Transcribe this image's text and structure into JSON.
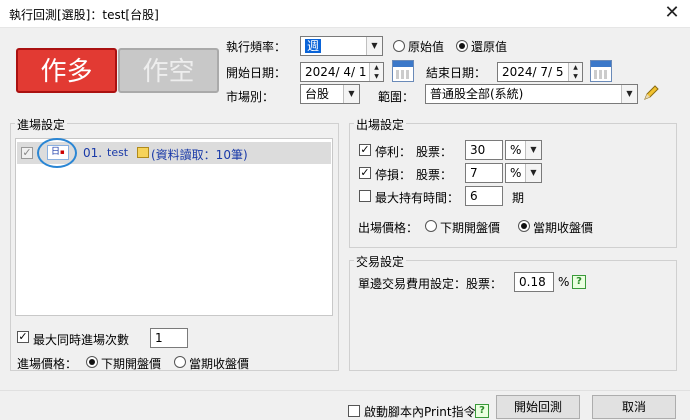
{
  "window": {
    "title": "執行回測[選股]：test[台股]",
    "close_glyph": "✕"
  },
  "direction": {
    "long_label": "作多",
    "short_label": "作空"
  },
  "freq": {
    "label": "執行頻率：",
    "value": "週",
    "radio_raw": "原始值",
    "radio_restored": "還原值"
  },
  "dates": {
    "start_label": "開始日期：",
    "start_value": "2024/ 4/ 1",
    "end_label": "結束日期：",
    "end_value": "2024/ 7/ 5"
  },
  "market": {
    "label": "市場別：",
    "value": "台股",
    "scope_label": "範圍：",
    "scope_value": "普通股全部(系統)"
  },
  "entry": {
    "title": "進場設定",
    "rows": [
      {
        "index": "01.",
        "name": "test",
        "info": "(資料讀取：10筆)",
        "tag": "日"
      }
    ],
    "max_label": "最大同時進場次數",
    "max_value": "1",
    "price_label": "進場價格：",
    "price_next_open": "下期開盤價",
    "price_current_close": "當期收盤價"
  },
  "exit": {
    "title": "出場設定",
    "stop_profit_label": "停利：",
    "stop_loss_label": "停損：",
    "stock_label": "股票：",
    "stop_profit_value": "30",
    "stop_loss_value": "7",
    "unit": "%",
    "hold_label": "最大持有時間：",
    "hold_value": "6",
    "hold_unit": "期",
    "price_label": "出場價格：",
    "price_next_open": "下期開盤價",
    "price_current_close": "當期收盤價"
  },
  "trade": {
    "title": "交易設定",
    "fee_label": "單邊交易費用設定：",
    "stock_label": "股票：",
    "fee_value": "0.18",
    "fee_unit": "%"
  },
  "footer": {
    "print_label": "啟動腳本內Print指令",
    "start_button": "開始回測",
    "cancel_button": "取消"
  },
  "icons": {
    "help": "?",
    "pencil": "pencil-icon",
    "calendar": "calendar-icon",
    "dropdown": "▼"
  },
  "colors": {
    "long": "#e23a33",
    "short_disabled": "#c8c8c8",
    "link_blue": "#1a3aa8",
    "help_green": "#2a8a2a"
  }
}
